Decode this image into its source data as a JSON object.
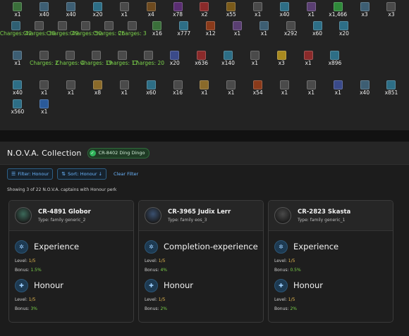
{
  "inventory": {
    "rows": [
      [
        {
          "name": "",
          "qty": "x1",
          "charges": "",
          "color": "#3a6f3a"
        },
        {
          "name": "",
          "qty": "x40",
          "charges": "",
          "color": "#3d5e73"
        },
        {
          "name": "",
          "qty": "x40",
          "charges": "",
          "color": "#3d5e73"
        },
        {
          "name": "",
          "qty": "x20",
          "charges": "",
          "color": "#2d6e86"
        },
        {
          "name": "",
          "qty": "x1",
          "charges": "",
          "color": "#4a4a4a"
        },
        {
          "name": "",
          "qty": "x4",
          "charges": "",
          "color": "#6d4a1f"
        },
        {
          "name": "",
          "qty": "x78",
          "charges": "",
          "color": "#5a2e72"
        },
        {
          "name": "",
          "qty": "x2",
          "charges": "",
          "color": "#8a2a2a"
        },
        {
          "name": "",
          "qty": "x55",
          "charges": "",
          "color": "#7a5a1a"
        },
        {
          "name": "",
          "qty": "x1",
          "charges": "",
          "color": "#4a4a4a"
        },
        {
          "name": "",
          "qty": "x40",
          "charges": "",
          "color": "#2d6e86"
        },
        {
          "name": "",
          "qty": "x1",
          "charges": "",
          "color": "#5a3f72"
        },
        {
          "name": "",
          "qty": "x1,466",
          "charges": "",
          "color": "#2f8a3a"
        },
        {
          "name": "",
          "qty": "x3",
          "charges": "",
          "color": "#3d5e73"
        },
        {
          "name": "",
          "qty": "x3",
          "charges": "",
          "color": "#4a4a4a"
        }
      ],
      [
        {
          "name": "",
          "qty": "",
          "charges": "Charges: 42",
          "color": "#2f5f73"
        },
        {
          "name": "",
          "qty": "",
          "charges": "Charges: 38",
          "color": "#4a4a4a"
        },
        {
          "name": "",
          "qty": "",
          "charges": "Charges: 49",
          "color": "#4a4a4a"
        },
        {
          "name": "",
          "qty": "",
          "charges": "Charges: 50",
          "color": "#4a4a4a"
        },
        {
          "name": "",
          "qty": "",
          "charges": "Charges: 26",
          "color": "#4a4a4a"
        },
        {
          "name": "",
          "qty": "",
          "charges": "Charges: 3",
          "color": "#4a4a4a"
        },
        {
          "name": "",
          "qty": "x16",
          "charges": "",
          "color": "#3a6f3a"
        },
        {
          "name": "",
          "qty": "x777",
          "charges": "",
          "color": "#2d6e86"
        },
        {
          "name": "",
          "qty": "x12",
          "charges": "",
          "color": "#8a3a1a"
        },
        {
          "name": "",
          "qty": "x1",
          "charges": "",
          "color": "#5a3f72"
        },
        {
          "name": "",
          "qty": "x1",
          "charges": "",
          "color": "#3d5e73"
        },
        {
          "name": "",
          "qty": "x292",
          "charges": "",
          "color": "#4a4a4a"
        },
        {
          "name": "",
          "qty": "x60",
          "charges": "",
          "color": "#2d6e86"
        },
        {
          "name": "",
          "qty": "x20",
          "charges": "",
          "color": "#2d6e86"
        }
      ],
      [
        {
          "name": "",
          "qty": "x1",
          "charges": "",
          "color": "#3d5e73"
        },
        {
          "name": "",
          "qty": "",
          "charges": "Charges: 2",
          "color": "#4a4a4a"
        },
        {
          "name": "",
          "qty": "",
          "charges": "Charges: 4",
          "color": "#4a4a4a"
        },
        {
          "name": "",
          "qty": "",
          "charges": "Charges: 19",
          "color": "#4a4a4a"
        },
        {
          "name": "",
          "qty": "",
          "charges": "Charges: 17",
          "color": "#4a4a4a"
        },
        {
          "name": "",
          "qty": "",
          "charges": "Charges: 20",
          "color": "#4a4a4a"
        },
        {
          "name": "",
          "qty": "x20",
          "charges": "",
          "color": "#3a4a8a"
        },
        {
          "name": "",
          "qty": "x636",
          "charges": "",
          "color": "#8a2a2a"
        },
        {
          "name": "",
          "qty": "x140",
          "charges": "",
          "color": "#2d6e86"
        },
        {
          "name": "",
          "qty": "x1",
          "charges": "",
          "color": "#4a4a4a"
        },
        {
          "name": "",
          "qty": "x3",
          "charges": "",
          "color": "#a8891f"
        },
        {
          "name": "",
          "qty": "x1",
          "charges": "",
          "color": "#8a2a2a"
        },
        {
          "name": "",
          "qty": "x896",
          "charges": "",
          "color": "#2d6e86"
        }
      ],
      [
        {
          "name": "",
          "qty": "x40",
          "charges": "",
          "color": "#2d6e86"
        },
        {
          "name": "",
          "qty": "x1",
          "charges": "",
          "color": "#4a4a4a"
        },
        {
          "name": "",
          "qty": "x1",
          "charges": "",
          "color": "#4a4a4a"
        },
        {
          "name": "",
          "qty": "x8",
          "charges": "",
          "color": "#8a6a2a"
        },
        {
          "name": "",
          "qty": "x1",
          "charges": "",
          "color": "#4a4a4a"
        },
        {
          "name": "",
          "qty": "x60",
          "charges": "",
          "color": "#2d6e86"
        },
        {
          "name": "",
          "qty": "x16",
          "charges": "",
          "color": "#4a4a4a"
        },
        {
          "name": "",
          "qty": "x1",
          "charges": "",
          "color": "#8a6a2a"
        },
        {
          "name": "",
          "qty": "x1",
          "charges": "",
          "color": "#4a4a4a"
        },
        {
          "name": "",
          "qty": "x54",
          "charges": "",
          "color": "#8a3a1a"
        },
        {
          "name": "",
          "qty": "x1",
          "charges": "",
          "color": "#4a4a4a"
        },
        {
          "name": "",
          "qty": "x1",
          "charges": "",
          "color": "#4a4a4a"
        },
        {
          "name": "",
          "qty": "x1",
          "charges": "",
          "color": "#3a4a8a"
        },
        {
          "name": "",
          "qty": "x40",
          "charges": "",
          "color": "#3d5e73"
        },
        {
          "name": "",
          "qty": "x851",
          "charges": "",
          "color": "#2d6e86"
        }
      ],
      [
        {
          "name": "",
          "qty": "x560",
          "charges": "",
          "color": "#2d6e86"
        },
        {
          "name": "",
          "qty": "x1",
          "charges": "",
          "color": "#2a5a9a"
        }
      ]
    ]
  },
  "collection": {
    "title": "N.O.V.A. Collection",
    "badge": "CR-8402 Ding Dingo",
    "filter_label": "Filter: Honour",
    "sort_label": "Sort: Honour ↓",
    "clear_label": "Clear Filter",
    "showing_text": "Showing 3 of 22 N.O.V.A. captains with Honour perk",
    "captains": [
      {
        "name": "CR-4891 Globor",
        "type": "Type: family generic_2",
        "avatar_color": "#3c6a5a",
        "perks": [
          {
            "name": "Experience",
            "icon": "✲",
            "level_label": "Level: ",
            "level": "1/5",
            "bonus_label": "Bonus: ",
            "bonus": "1.5%"
          },
          {
            "name": "Honour",
            "icon": "✚",
            "level_label": "Level: ",
            "level": "1/5",
            "bonus_label": "Bonus: ",
            "bonus": "3%"
          }
        ]
      },
      {
        "name": "CR-3965 Judix Lerr",
        "type": "Type: family eos_3",
        "avatar_color": "#3a5070",
        "perks": [
          {
            "name": "Completion-experience",
            "icon": "✲",
            "level_label": "Level: ",
            "level": "1/5",
            "bonus_label": "Bonus: ",
            "bonus": "4%"
          },
          {
            "name": "Honour",
            "icon": "✚",
            "level_label": "Level: ",
            "level": "1/5",
            "bonus_label": "Bonus: ",
            "bonus": "2%"
          }
        ]
      },
      {
        "name": "CR-2823 Skasta",
        "type": "Type: family generic_1",
        "avatar_color": "#4a4a4a",
        "perks": [
          {
            "name": "Experience",
            "icon": "✲",
            "level_label": "Level: ",
            "level": "1/5",
            "bonus_label": "Bonus: ",
            "bonus": "0.5%"
          },
          {
            "name": "Honour",
            "icon": "✚",
            "level_label": "Level: ",
            "level": "1/5",
            "bonus_label": "Bonus: ",
            "bonus": "2%"
          }
        ]
      }
    ]
  }
}
